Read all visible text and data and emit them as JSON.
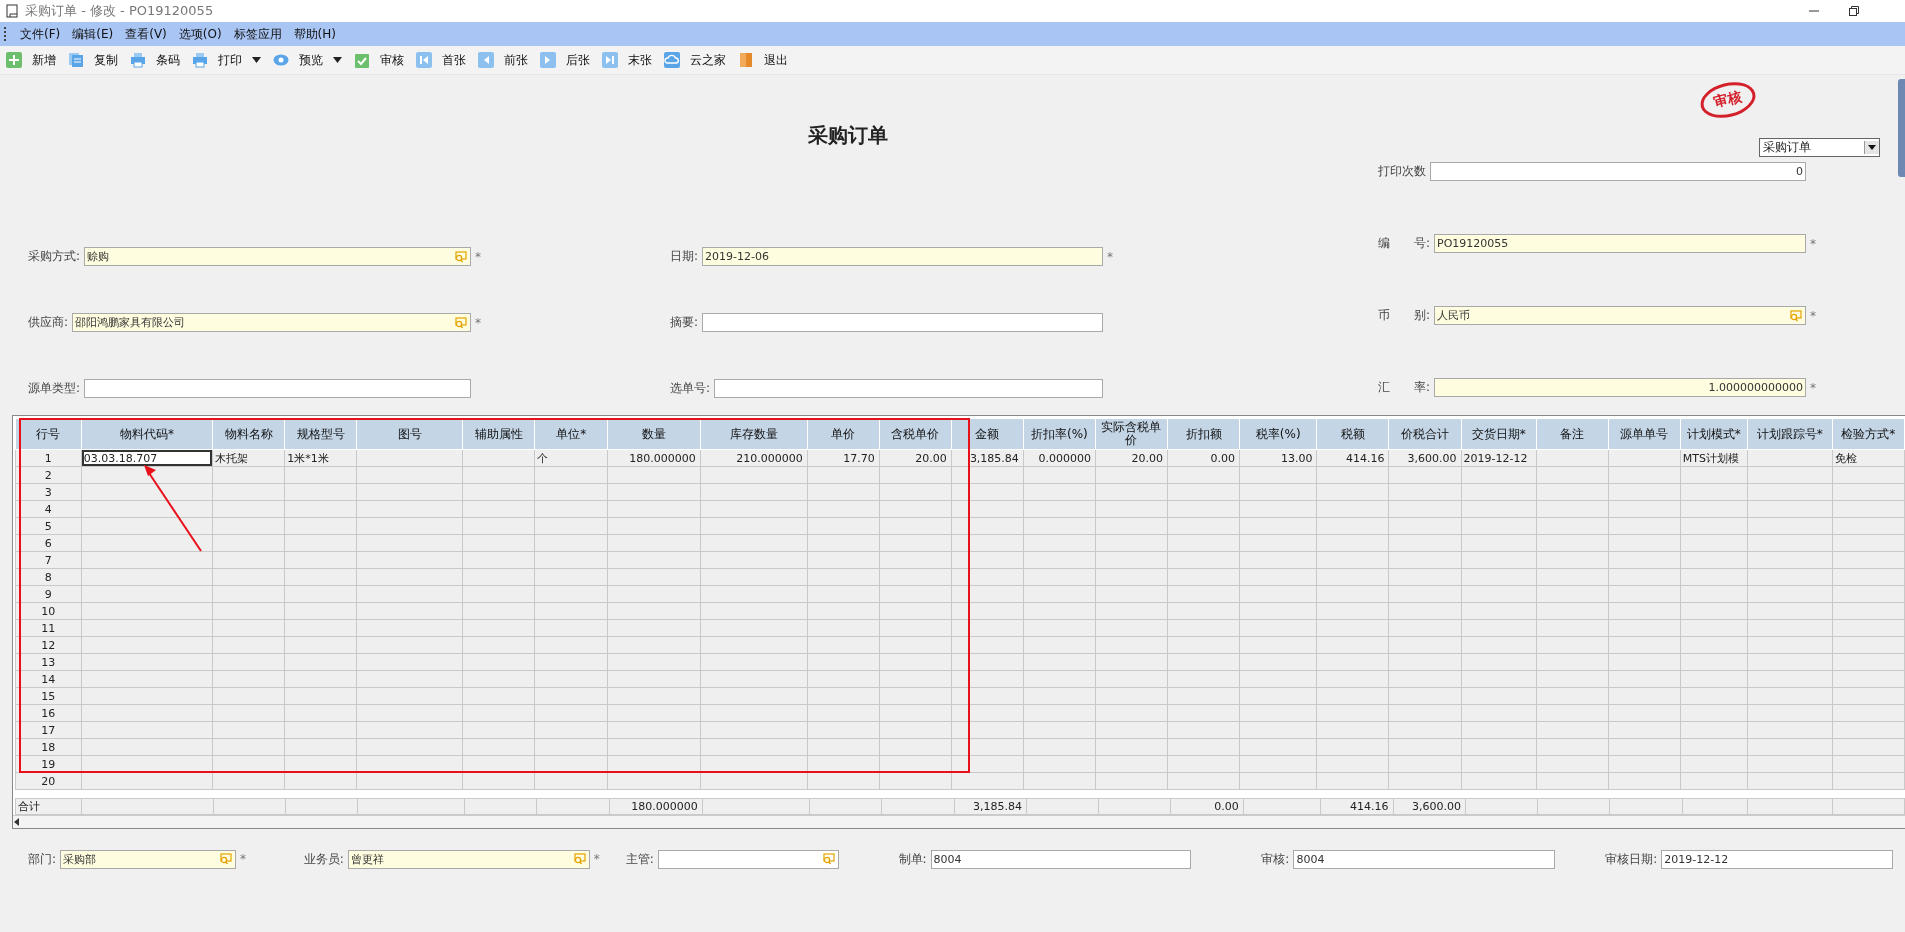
{
  "window": {
    "title": "采购订单 - 修改 - PO19120055"
  },
  "menu": [
    {
      "label": "文件(F)"
    },
    {
      "label": "编辑(E)"
    },
    {
      "label": "查看(V)"
    },
    {
      "label": "选项(O)"
    },
    {
      "label": "标签应用"
    },
    {
      "label": "帮助(H)"
    }
  ],
  "toolbar": [
    {
      "label": "新增",
      "dropdown": false
    },
    {
      "label": "复制",
      "dropdown": false
    },
    {
      "label": "条码",
      "dropdown": false
    },
    {
      "label": "打印",
      "dropdown": true
    },
    {
      "label": "预览",
      "dropdown": true
    },
    {
      "label": "审核",
      "dropdown": false
    },
    {
      "label": "首张",
      "dropdown": false
    },
    {
      "label": "前张",
      "dropdown": false
    },
    {
      "label": "后张",
      "dropdown": false
    },
    {
      "label": "末张",
      "dropdown": false
    },
    {
      "label": "云之家",
      "dropdown": false
    },
    {
      "label": "退出",
      "dropdown": false
    }
  ],
  "stamp": "审核",
  "form_title": "采购订单",
  "template_select": {
    "value": "采购订单"
  },
  "left_fields": [
    {
      "label": "采购方式:",
      "value": "赊购",
      "numeric": false,
      "required": true,
      "mark": "*",
      "lookup": true
    },
    {
      "label": "供应商:",
      "value": "邵阳鸿鹏家具有限公司",
      "numeric": false,
      "required": true,
      "mark": "*",
      "lookup": true
    },
    {
      "label": "源单类型:",
      "required": false,
      "lookup": false
    }
  ],
  "middle_fields": [
    {
      "label": "日期:",
      "value": "2019-12-06",
      "numeric": false,
      "required": true,
      "mark": "*",
      "lookup": false
    },
    {
      "label": "摘要:",
      "required": false,
      "lookup": false
    },
    {
      "label": "选单号:",
      "required": false,
      "lookup": false
    }
  ],
  "right_fields": [
    {
      "label": "打印次数",
      "value": "0",
      "numeric": true,
      "required": false,
      "lookup": false
    },
    {
      "label": "编　　号:",
      "value": "PO19120055",
      "numeric": false,
      "required": true,
      "mark": "*",
      "lookup": false
    },
    {
      "label": "币　　别:",
      "value": "人民币",
      "numeric": false,
      "required": true,
      "mark": "*",
      "lookup": true
    },
    {
      "label": "汇　　率:",
      "value": "1.000000000000",
      "numeric": true,
      "required": true,
      "mark": "*",
      "lookup": false
    }
  ],
  "table": {
    "columns": [
      {
        "header": "行号",
        "total": "合计"
      },
      {
        "header": "物料代码*",
        "numeric": false
      },
      {
        "header": "物料名称",
        "numeric": false
      },
      {
        "header": "规格型号",
        "numeric": false
      },
      {
        "header": "图号"
      },
      {
        "header": "辅助属性"
      },
      {
        "header": "单位*",
        "numeric": false
      },
      {
        "header": "数量",
        "numeric": true,
        "total": "180.000000"
      },
      {
        "header": "库存数量",
        "numeric": true
      },
      {
        "header": "单价",
        "numeric": true
      },
      {
        "header": "含税单价",
        "numeric": true
      },
      {
        "header": "金额",
        "numeric": true,
        "total": "3,185.84"
      },
      {
        "header": "折扣率(%)",
        "numeric": true
      },
      {
        "header": "实际含税单价",
        "numeric": true
      },
      {
        "header": "折扣额",
        "numeric": true,
        "total": "0.00"
      },
      {
        "header": "税率(%)",
        "numeric": true
      },
      {
        "header": "税额",
        "numeric": true,
        "total": "414.16"
      },
      {
        "header": "价税合计",
        "numeric": true,
        "total": "3,600.00"
      },
      {
        "header": "交货日期*",
        "numeric": false
      },
      {
        "header": "备注"
      },
      {
        "header": "源单单号"
      },
      {
        "header": "计划模式*",
        "numeric": false
      },
      {
        "header": "计划跟踪号*"
      },
      {
        "header": "检验方式*",
        "numeric": false
      }
    ],
    "rows": [
      {
        "no": "1",
        "cells": [
          {
            "text": "03.03.18.707",
            "selected": true
          },
          {
            "text": "木托架",
            "selected": false
          },
          {
            "text": "1米*1米",
            "selected": false
          },
          null,
          null,
          {
            "text": "个",
            "selected": false
          },
          {
            "text": "180.000000",
            "selected": false
          },
          {
            "text": "210.000000",
            "selected": false
          },
          {
            "text": "17.70",
            "selected": false
          },
          {
            "text": "20.00",
            "selected": false
          },
          {
            "text": "3,185.84",
            "selected": false
          },
          {
            "text": "0.000000",
            "selected": false
          },
          {
            "text": "20.00",
            "selected": false
          },
          {
            "text": "0.00",
            "selected": false
          },
          {
            "text": "13.00",
            "selected": false
          },
          {
            "text": "414.16",
            "selected": false
          },
          {
            "text": "3,600.00",
            "selected": false
          },
          {
            "text": "2019-12-12",
            "selected": false
          },
          null,
          null,
          {
            "text": "MTS计划模",
            "selected": false
          },
          null,
          {
            "text": "免检",
            "selected": false
          }
        ]
      },
      {
        "no": "2"
      },
      {
        "no": "3"
      },
      {
        "no": "4"
      },
      {
        "no": "5"
      },
      {
        "no": "6"
      },
      {
        "no": "7"
      },
      {
        "no": "8"
      },
      {
        "no": "9"
      },
      {
        "no": "10"
      },
      {
        "no": "11"
      },
      {
        "no": "12"
      },
      {
        "no": "13"
      },
      {
        "no": "14"
      },
      {
        "no": "15"
      },
      {
        "no": "16"
      },
      {
        "no": "17"
      },
      {
        "no": "18"
      },
      {
        "no": "19"
      },
      {
        "no": "20"
      }
    ]
  },
  "footer_fields": [
    {
      "label": "部门:",
      "value": "采购部",
      "required": true,
      "mark": "*",
      "lookup": true
    },
    {
      "label": "业务员:",
      "value": "曾更祥",
      "required": true,
      "mark": "*",
      "lookup": true
    },
    {
      "label": "主管:",
      "required": false,
      "lookup": true
    },
    {
      "label": "制单:",
      "value": "8004",
      "required": false,
      "lookup": false
    },
    {
      "label": "审核:",
      "value": "8004",
      "required": false,
      "lookup": false
    },
    {
      "label": "审核日期:",
      "value": "2019-12-12",
      "required": false,
      "lookup": false
    }
  ]
}
